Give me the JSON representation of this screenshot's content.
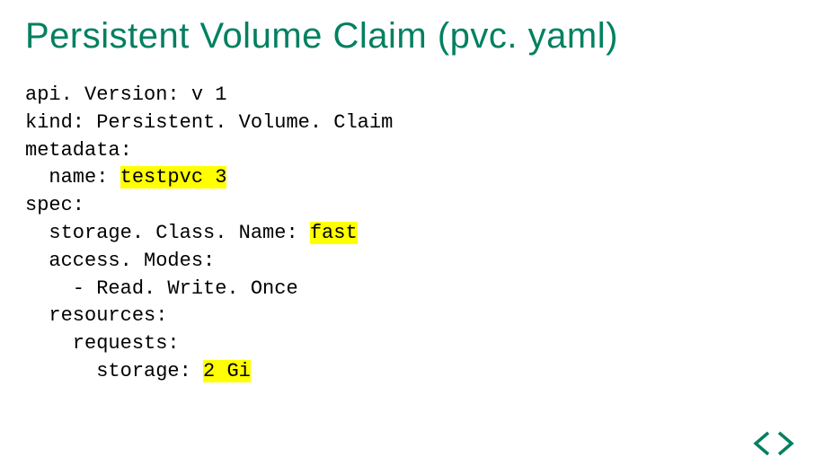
{
  "title": "Persistent Volume Claim (pvc. yaml)",
  "code": {
    "l1": "api. Version: v 1",
    "l2": "kind: Persistent. Volume. Claim",
    "l3": "metadata:",
    "l4a": "  name: ",
    "l4b": "testpvc 3",
    "l5": "spec:",
    "l6a": "  storage. Class. Name: ",
    "l6b": "fast",
    "l7": "  access. Modes:",
    "l8": "    - Read. Write. Once",
    "l9": "  resources:",
    "l10": "    requests:",
    "l11a": "      storage: ",
    "l11b": "2 Gi"
  }
}
